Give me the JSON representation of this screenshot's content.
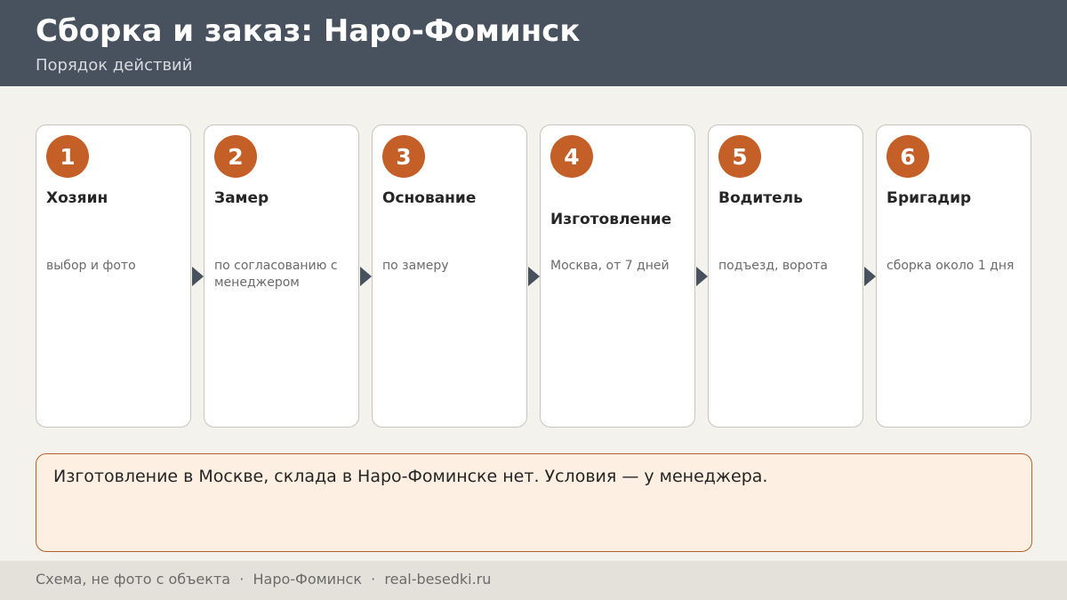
{
  "header": {
    "title": "Сборка и заказ: Наро-Фоминск",
    "subtitle": "Порядок действий"
  },
  "steps": [
    {
      "number": "1",
      "title": "Хозяин",
      "description": "выбор и фото"
    },
    {
      "number": "2",
      "title": "Замер",
      "description": "по согласованию с менеджером"
    },
    {
      "number": "3",
      "title": "Основание",
      "description": "по замеру"
    },
    {
      "number": "4",
      "title": "Изготовление",
      "description": "Москва, от 7 дней"
    },
    {
      "number": "5",
      "title": "Водитель",
      "description": "подъезд, ворота"
    },
    {
      "number": "6",
      "title": "Бригадир",
      "description": "сборка около 1 дня"
    }
  ],
  "note": {
    "text": "Изготовление в Москве, склада в Наро-Фоминске нет. Условия — у менеджера."
  },
  "footer": {
    "text": "Схема, не фото с объекта  ·  Наро-Фоминск  ·  real-besedki.ru"
  },
  "colors": {
    "header_bg": "#48525f",
    "badge": "#c45f27",
    "note_bg": "#fdefe2",
    "note_border": "#b4612f"
  }
}
